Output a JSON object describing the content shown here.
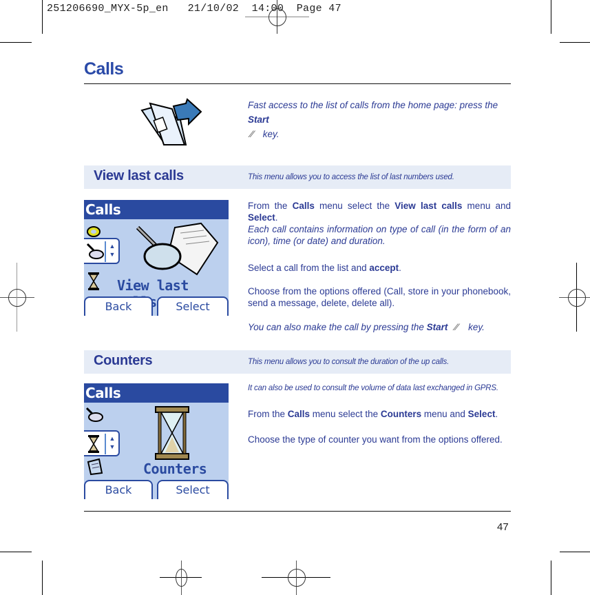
{
  "slug": {
    "text": "251206690_MYX-5p_en   21/10/02  14:00  Page 47"
  },
  "page": {
    "title": "Calls",
    "number": "47"
  },
  "intro": {
    "text_before": "Fast access to the list of calls from the home page: press the ",
    "key_bold": "Start",
    "text_after": " key.",
    "key_icon": "start-key-icon"
  },
  "sections": [
    {
      "title": "View last calls",
      "description": "This menu allows you to access the list of last numbers used.",
      "phone": {
        "header": "Calls",
        "label": "View last calls",
        "softkeys": [
          "Back",
          "Select"
        ],
        "icons": [
          "phone-call-icon",
          "magnifier-icon",
          "hourglass-icon"
        ],
        "illustration": "magnifier-list-icon"
      },
      "para1": {
        "t1": "From the ",
        "b1": "Calls",
        "t2": " menu select the ",
        "b2": "View last calls",
        "t3": " menu and ",
        "b3": "Select",
        "t4": "."
      },
      "para1_italic": "Each call contains information on type of call (in the form of an icon), time (or date) and duration.",
      "para2": {
        "t1": "Select a call from the list and ",
        "b1": "accept",
        "t2": "."
      },
      "para3": "Choose from the options offered (Call, store in your phonebook, send a message, delete, delete all).",
      "para4": {
        "t1": "You can also make the call by pressing the ",
        "b1": "Start",
        "t2": " key."
      }
    },
    {
      "title": "Counters",
      "description": "This menu allows you to consult the duration of the up calls.",
      "phone": {
        "header": "Calls",
        "label": "Counters",
        "softkeys": [
          "Back",
          "Select"
        ],
        "icons": [
          "magnifier-icon",
          "hourglass-icon",
          "contact-card-icon"
        ],
        "illustration": "hourglass-large-icon"
      },
      "para1_italic": "It can also be used to consult the volume of data last exchanged in GPRS.",
      "para2": {
        "t1": "From the ",
        "b1": "Calls",
        "t2": " menu select the ",
        "b2": "Counters",
        "t3": " menu and ",
        "b3": "Select",
        "t4": "."
      },
      "para3": "Choose the type of counter you want from the options offered."
    }
  ],
  "colors": {
    "accent": "#2a4aa8",
    "text": "#2b3a94",
    "band": "#e6ecf6",
    "phone_bg": "#bcd0ee",
    "phone_bar": "#2a4aa0"
  }
}
